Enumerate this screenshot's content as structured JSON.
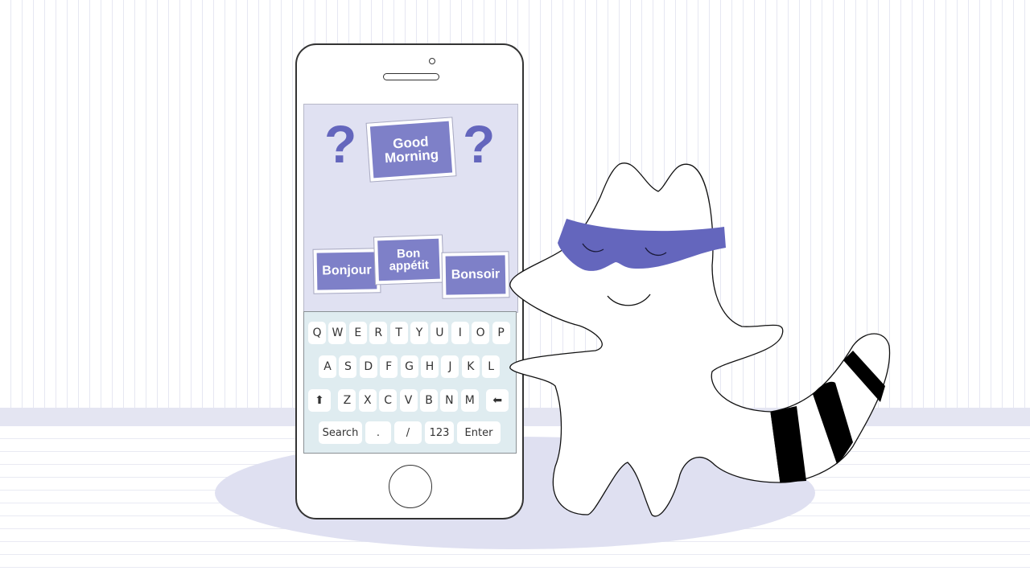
{
  "scene": {
    "description": "Illustration of a smartphone showing language flashcards next to a masked raccoon character",
    "colors": {
      "accent_purple": "#6466bd",
      "card_purple": "#7e80c8",
      "screen_bg": "#e0e1f2",
      "keyboard_bg": "#dfecf0",
      "floor_band": "#e4e5f2",
      "shadow": "#dfe0f1"
    }
  },
  "phone": {
    "screen": {
      "question_mark_left": "?",
      "question_mark_right": "?",
      "prompt_card": "Good Morning",
      "answer_cards": [
        {
          "label": "Bonjour"
        },
        {
          "label": "Bon appétit"
        },
        {
          "label": "Bonsoir"
        }
      ]
    },
    "keyboard": {
      "row1": [
        "Q",
        "W",
        "E",
        "R",
        "T",
        "Y",
        "U",
        "I",
        "O",
        "P"
      ],
      "row2": [
        "A",
        "S",
        "D",
        "F",
        "G",
        "H",
        "J",
        "K",
        "L"
      ],
      "row3": [
        "⬆",
        "Z",
        "X",
        "C",
        "V",
        "B",
        "N",
        "M",
        "⬅"
      ],
      "row4": [
        "Search",
        ".",
        "/",
        "123",
        "Enter"
      ]
    }
  },
  "character": {
    "name": "raccoon",
    "mask_color": "#6466bd",
    "tail_stripes": "black"
  }
}
